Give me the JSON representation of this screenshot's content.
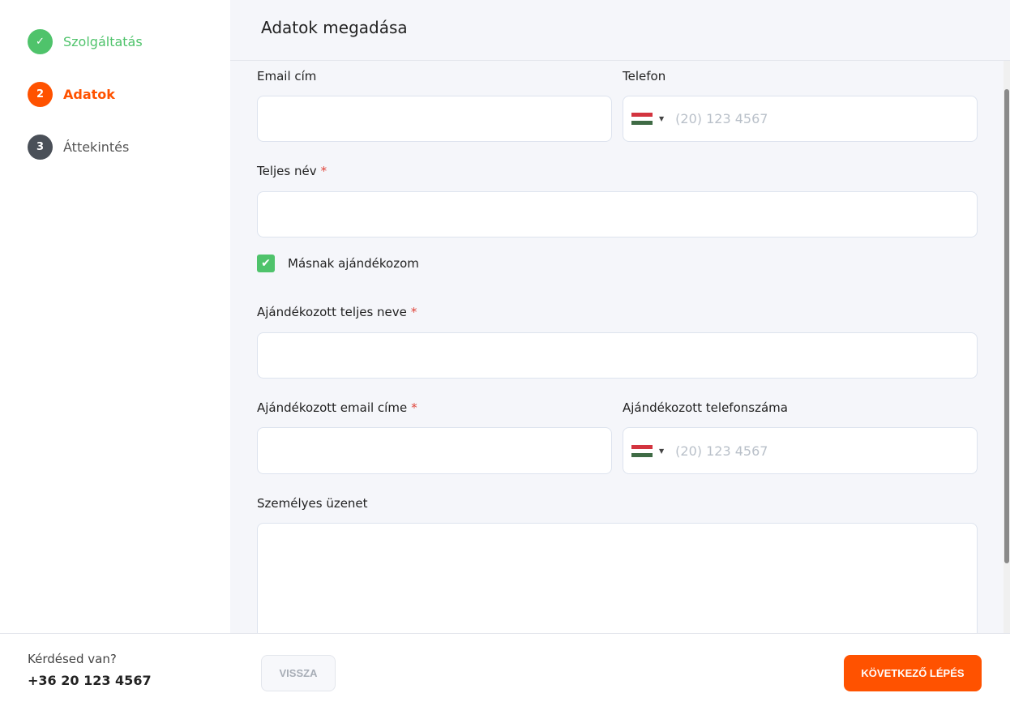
{
  "steps": [
    {
      "num": "✓",
      "label": "Szolgáltatás",
      "color": "#4fc36b",
      "state": "done"
    },
    {
      "num": "2",
      "label": "Adatok",
      "color": "#ff5200",
      "state": "active"
    },
    {
      "num": "3",
      "label": "Áttekintés",
      "color": "#4a5058",
      "state": "pending"
    }
  ],
  "header": {
    "title": "Adatok megadása"
  },
  "form": {
    "email_label": "Email cím",
    "phone_label": "Telefon",
    "phone_placeholder": "(20) 123 4567",
    "name_label": "Teljes név",
    "required_mark": "*",
    "gift_checkbox_label": "Másnak ajándékozom",
    "gift_checked": true,
    "gift_name_label": "Ajándékozott teljes neve",
    "gift_email_label": "Ajándékozott email címe",
    "gift_phone_label": "Ajándékozott telefonszáma",
    "gift_phone_placeholder": "(20) 123 4567",
    "message_label": "Személyes üzenet"
  },
  "footer": {
    "question": "Kérdésed van?",
    "phone": "+36 20 123 4567",
    "back_label": "VISSZA",
    "next_label": "KÖVETKEZŐ LÉPÉS"
  }
}
